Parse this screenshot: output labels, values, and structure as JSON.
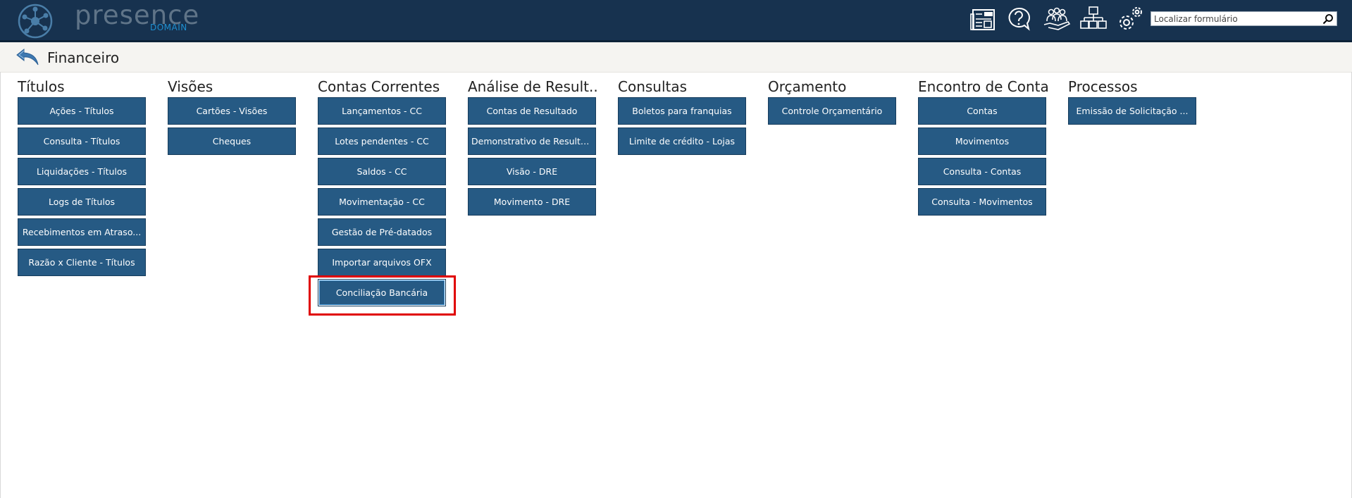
{
  "header": {
    "logo_text": "presence",
    "logo_sub": "DOMAIN",
    "icons": [
      "news-icon",
      "help-icon",
      "users-icon",
      "org-chart-icon",
      "settings-icon"
    ],
    "search_placeholder": "Localizar formulário"
  },
  "page": {
    "title": "Financeiro"
  },
  "columns": [
    {
      "title": "Títulos",
      "items": [
        "Ações - Títulos",
        "Consulta - Títulos",
        "Liquidações - Títulos",
        "Logs de Títulos",
        "Recebimentos em Atraso...",
        "Razão x Cliente - Títulos"
      ]
    },
    {
      "title": "Visões",
      "items": [
        "Cartões - Visões",
        "Cheques"
      ]
    },
    {
      "title": "Contas Correntes",
      "items": [
        "Lançamentos - CC",
        "Lotes pendentes - CC",
        "Saldos - CC",
        "Movimentação - CC",
        "Gestão de Pré-datados",
        "Importar arquivos OFX",
        "Conciliação Bancária"
      ]
    },
    {
      "title": "Análise de Result...",
      "items": [
        "Contas de Resultado",
        "Demonstrativo de Resultad...",
        "Visão - DRE",
        "Movimento - DRE"
      ]
    },
    {
      "title": "Consultas",
      "items": [
        "Boletos para franquias",
        "Limite de crédito - Lojas"
      ]
    },
    {
      "title": "Orçamento",
      "items": [
        "Controle Orçamentário"
      ]
    },
    {
      "title": "Encontro de Contas",
      "items": [
        "Contas",
        "Movimentos",
        "Consulta - Contas",
        "Consulta - Movimentos"
      ]
    },
    {
      "title": "Processos",
      "items": [
        "Emissão de Solicitação ..."
      ]
    }
  ],
  "colors": {
    "header_bg": "#17324f",
    "button_bg": "#265a84",
    "highlight": "#e00000"
  }
}
